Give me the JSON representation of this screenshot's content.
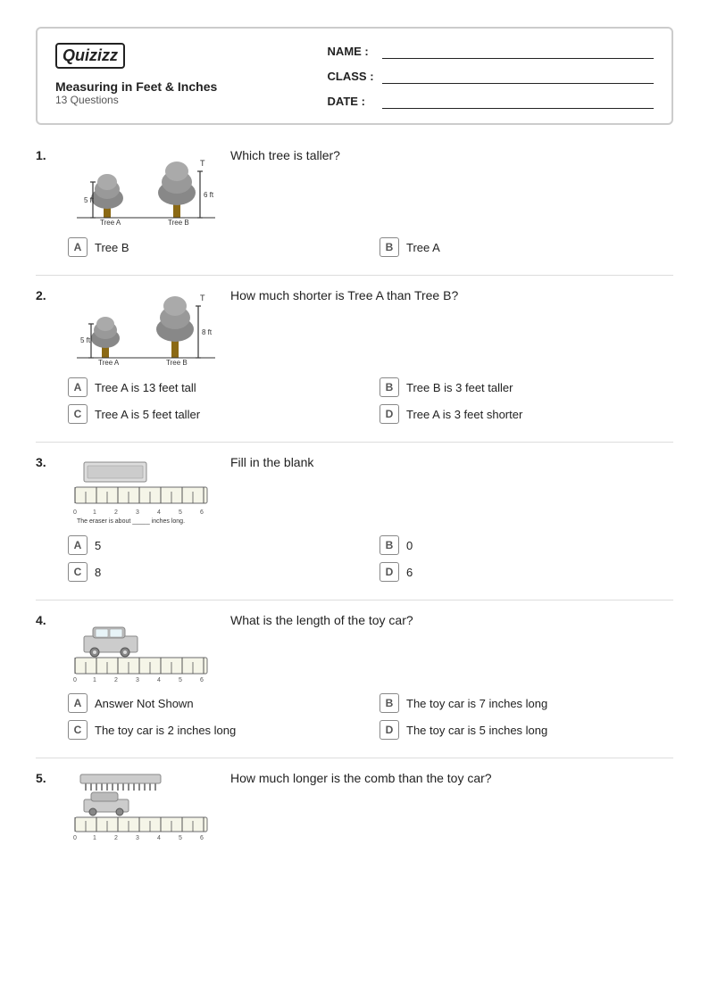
{
  "header": {
    "logo_text": "Quizizz",
    "quiz_title": "Measuring in Feet & Inches",
    "quiz_subtitle": "13 Questions",
    "name_label": "NAME :",
    "class_label": "CLASS :",
    "date_label": "DATE :"
  },
  "questions": [
    {
      "number": "1.",
      "text": "Which tree is taller?",
      "options": [
        {
          "letter": "A",
          "text": "Tree B"
        },
        {
          "letter": "B",
          "text": "Tree A"
        },
        {
          "letter": "C",
          "text": ""
        },
        {
          "letter": "D",
          "text": ""
        }
      ],
      "type": "trees1"
    },
    {
      "number": "2.",
      "text": "How much shorter is Tree A than Tree B?",
      "options": [
        {
          "letter": "A",
          "text": "Tree A is 13 feet tall"
        },
        {
          "letter": "B",
          "text": "Tree B is 3 feet taller"
        },
        {
          "letter": "C",
          "text": "Tree A is 5 feet taller"
        },
        {
          "letter": "D",
          "text": "Tree A is 3 feet shorter"
        }
      ],
      "type": "trees2"
    },
    {
      "number": "3.",
      "text": "Fill in the blank",
      "options": [
        {
          "letter": "A",
          "text": "5"
        },
        {
          "letter": "B",
          "text": "0"
        },
        {
          "letter": "C",
          "text": "8"
        },
        {
          "letter": "D",
          "text": "6"
        }
      ],
      "type": "ruler_eraser"
    },
    {
      "number": "4.",
      "text": "What is the length of the toy car?",
      "options": [
        {
          "letter": "A",
          "text": "Answer Not Shown"
        },
        {
          "letter": "B",
          "text": "The toy car is 7 inches long"
        },
        {
          "letter": "C",
          "text": "The toy car is 2 inches long"
        },
        {
          "letter": "D",
          "text": "The toy car is 5 inches long"
        }
      ],
      "type": "toy_car"
    },
    {
      "number": "5.",
      "text": "How much longer is the comb than the toy car?",
      "options": [],
      "type": "comb_car"
    }
  ]
}
